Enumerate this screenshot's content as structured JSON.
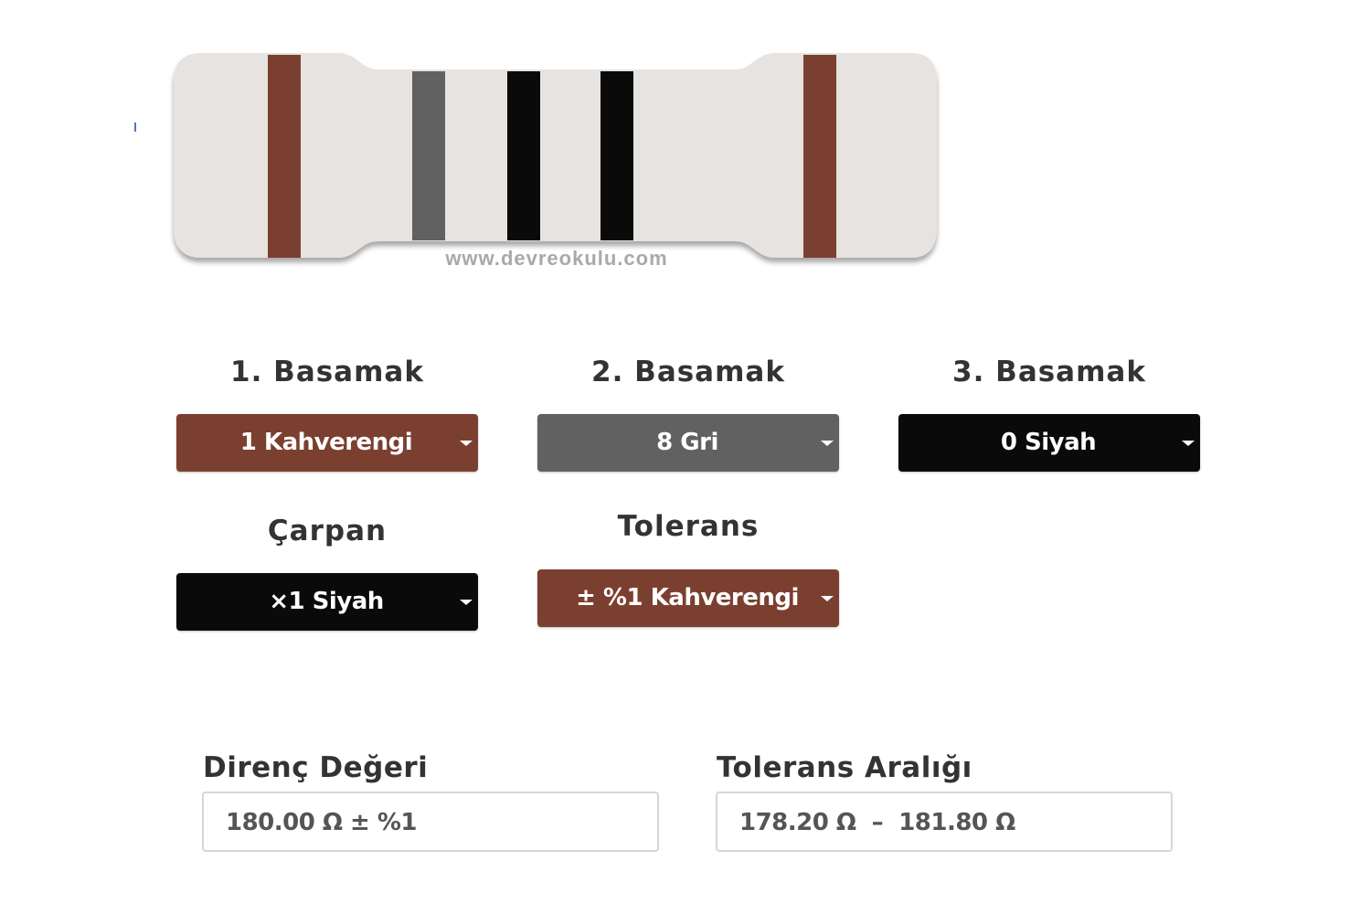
{
  "resistor": {
    "watermark": "www.devreokulu.com",
    "body_color": "#e6e3e0",
    "bands": [
      {
        "role": "digit1",
        "color": "#7b3f30"
      },
      {
        "role": "digit2",
        "color": "#616161"
      },
      {
        "role": "digit3",
        "color": "#0a0a0a"
      },
      {
        "role": "multiplier",
        "color": "#0a0a0a"
      },
      {
        "role": "tolerance",
        "color": "#7b3f30"
      }
    ]
  },
  "fields": {
    "digit1": {
      "label": "1. Basamak",
      "value": "1 Kahverengi",
      "color": "#7b3f30"
    },
    "digit2": {
      "label": "2. Basamak",
      "value": "8 Gri",
      "color": "#616161"
    },
    "digit3": {
      "label": "3. Basamak",
      "value": "0 Siyah",
      "color": "#0a0a0a"
    },
    "multiplier": {
      "label": "Çarpan",
      "value": "×1 Siyah",
      "color": "#0a0a0a"
    },
    "tolerance": {
      "label": "Tolerans",
      "value": "± %1 Kahverengi",
      "color": "#7b3f30"
    }
  },
  "results": {
    "resistance": {
      "label": "Direnç Değeri",
      "value": "180.00 Ω ± %1"
    },
    "tolerance_range": {
      "label": "Tolerans Aralığı",
      "value": "178.20 Ω  –  181.80 Ω"
    }
  },
  "icons": {
    "caret": "caret-down-icon"
  }
}
